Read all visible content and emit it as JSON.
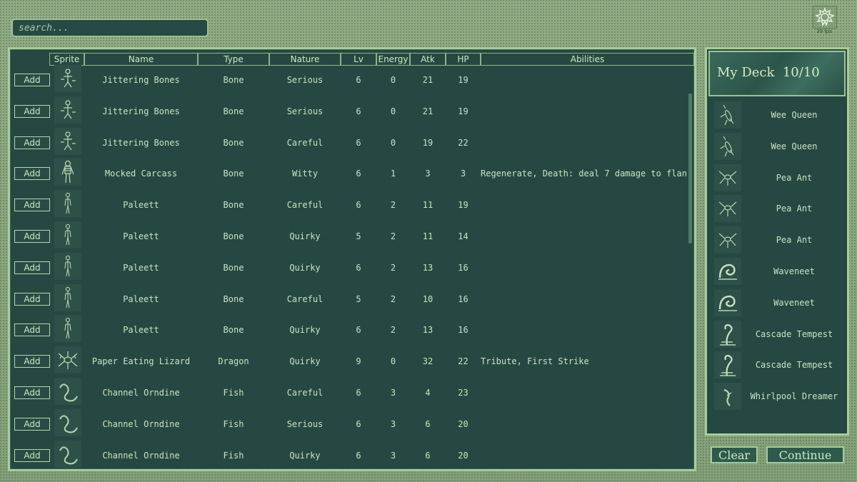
{
  "search": {
    "placeholder": "search..."
  },
  "fps": "39 fps",
  "columns": [
    "Sprite",
    "Name",
    "Type",
    "Nature",
    "Lv",
    "Energy",
    "Atk",
    "HP",
    "Abilities"
  ],
  "add_label": "Add",
  "rows": [
    {
      "sprite": "skeleton-bones",
      "name": "Jittering Bones",
      "type": "Bone",
      "nature": "Serious",
      "lv": "6",
      "energy": "0",
      "atk": "21",
      "hp": "19",
      "abilities": ""
    },
    {
      "sprite": "skeleton-bones",
      "name": "Jittering Bones",
      "type": "Bone",
      "nature": "Serious",
      "lv": "6",
      "energy": "0",
      "atk": "21",
      "hp": "19",
      "abilities": ""
    },
    {
      "sprite": "skeleton-bones",
      "name": "Jittering Bones",
      "type": "Bone",
      "nature": "Careful",
      "lv": "6",
      "energy": "0",
      "atk": "19",
      "hp": "22",
      "abilities": ""
    },
    {
      "sprite": "skeleton",
      "name": "Mocked Carcass",
      "type": "Bone",
      "nature": "Witty",
      "lv": "6",
      "energy": "1",
      "atk": "3",
      "hp": "3",
      "abilities": "Regenerate, Death:  deal 7  damage to flan"
    },
    {
      "sprite": "thin-skeleton",
      "name": "Paleett",
      "type": "Bone",
      "nature": "Careful",
      "lv": "6",
      "energy": "2",
      "atk": "11",
      "hp": "19",
      "abilities": ""
    },
    {
      "sprite": "thin-skeleton",
      "name": "Paleett",
      "type": "Bone",
      "nature": "Quirky",
      "lv": "5",
      "energy": "2",
      "atk": "11",
      "hp": "14",
      "abilities": ""
    },
    {
      "sprite": "thin-skeleton",
      "name": "Paleett",
      "type": "Bone",
      "nature": "Quirky",
      "lv": "6",
      "energy": "2",
      "atk": "13",
      "hp": "16",
      "abilities": ""
    },
    {
      "sprite": "thin-skeleton",
      "name": "Paleett",
      "type": "Bone",
      "nature": "Careful",
      "lv": "5",
      "energy": "2",
      "atk": "10",
      "hp": "16",
      "abilities": ""
    },
    {
      "sprite": "thin-skeleton",
      "name": "Paleett",
      "type": "Bone",
      "nature": "Quirky",
      "lv": "6",
      "energy": "2",
      "atk": "13",
      "hp": "16",
      "abilities": ""
    },
    {
      "sprite": "lizard",
      "name": "Paper Eating Lizard",
      "type": "Dragon",
      "nature": "Quirky",
      "lv": "9",
      "energy": "0",
      "atk": "32",
      "hp": "22",
      "abilities": "Tribute, First Strike"
    },
    {
      "sprite": "eel",
      "name": "Channel Orndine",
      "type": "Fish",
      "nature": "Careful",
      "lv": "6",
      "energy": "3",
      "atk": "4",
      "hp": "23",
      "abilities": ""
    },
    {
      "sprite": "eel",
      "name": "Channel Orndine",
      "type": "Fish",
      "nature": "Serious",
      "lv": "6",
      "energy": "3",
      "atk": "6",
      "hp": "20",
      "abilities": ""
    },
    {
      "sprite": "eel",
      "name": "Channel Orndine",
      "type": "Fish",
      "nature": "Quirky",
      "lv": "6",
      "energy": "3",
      "atk": "6",
      "hp": "20",
      "abilities": ""
    }
  ],
  "deck": {
    "title": "My Deck",
    "count": "10/10",
    "items": [
      {
        "sprite": "insect",
        "name": "Wee Queen"
      },
      {
        "sprite": "insect",
        "name": "Wee Queen"
      },
      {
        "sprite": "ant",
        "name": "Pea Ant"
      },
      {
        "sprite": "ant",
        "name": "Pea Ant"
      },
      {
        "sprite": "ant",
        "name": "Pea Ant"
      },
      {
        "sprite": "wave",
        "name": "Waveneet"
      },
      {
        "sprite": "wave",
        "name": "Waveneet"
      },
      {
        "sprite": "tempest",
        "name": "Cascade Tempest"
      },
      {
        "sprite": "tempest",
        "name": "Cascade Tempest"
      },
      {
        "sprite": "dreamer",
        "name": "Whirlpool Dreamer"
      }
    ]
  },
  "buttons": {
    "clear": "Clear",
    "continue": "Continue"
  },
  "colors": {
    "panel": "#264842",
    "border": "#a9cc9d",
    "text": "#c9e3c1",
    "background": "#8da87f"
  }
}
